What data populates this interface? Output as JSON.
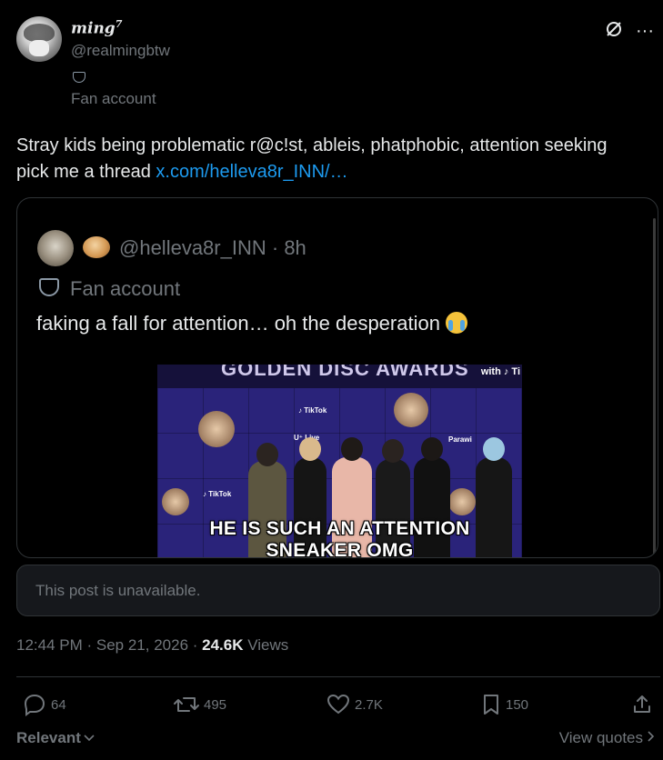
{
  "author": {
    "display_name": "ming",
    "display_name_sup": "7",
    "handle": "@realmingbtw",
    "badge_icon": "mask-icon",
    "label": "Fan account"
  },
  "top_actions": {
    "icons": [
      "grok-icon",
      "more-icon"
    ],
    "more": "···",
    "grok": "∅"
  },
  "post": {
    "text": "Stray kids being problematic r@c!st, ableis,  phatphobic, attention seeking pick me a thread ",
    "link": "x.com/helleva8r_INN/…"
  },
  "quote": {
    "handle": "@helleva8r_INN",
    "time": "8h",
    "separator": "·",
    "label": "Fan account",
    "text": "faking a fall for attention… oh the desperation",
    "media": {
      "banner": "GOLDEN DISC AWARDS",
      "tiktok": "with ♪ Ti",
      "caption_line1": "HE IS SUCH AN ATTENTION",
      "caption_line2": "SNEAKER OMG"
    }
  },
  "unavailable": "This post is unavailable.",
  "meta": {
    "time": "12:44 PM · Sep 21, 2026 · ",
    "views_count": "24.6K",
    "views_label": " Views"
  },
  "actions": {
    "replies": "64",
    "reposts": "495",
    "likes": "2.7K",
    "bookmarks": "150"
  },
  "footer": {
    "relevant": "Relevant",
    "view_quotes": "View quotes"
  },
  "colors": {
    "bg": "#000000",
    "text": "#e7e9ea",
    "muted": "#71767b",
    "link": "#1d9bf0",
    "border": "#2f3336"
  }
}
